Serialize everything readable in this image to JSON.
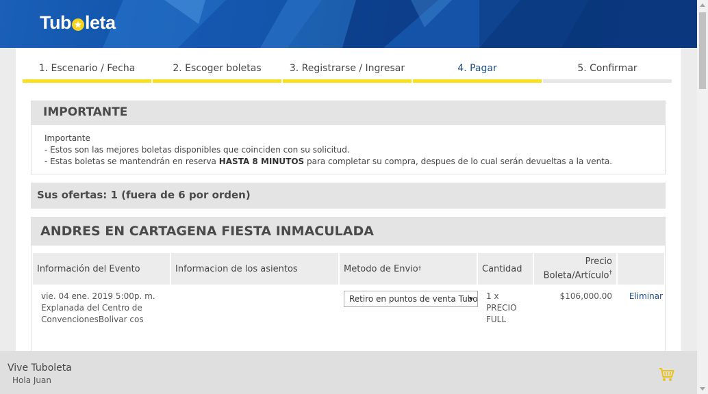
{
  "brand": {
    "logo_pre": "Tub",
    "logo_post": "leta",
    "accent_color": "#f7e11f",
    "header_color": "#0c4fa3"
  },
  "steps": [
    {
      "label": "1. Escenario / Fecha",
      "state": "done"
    },
    {
      "label": "2. Escoger boletas",
      "state": "done"
    },
    {
      "label": "3. Registrarse / Ingresar",
      "state": "done"
    },
    {
      "label": "4. Pagar",
      "state": "active"
    },
    {
      "label": "5. Confirmar",
      "state": "future"
    }
  ],
  "important": {
    "heading": "IMPORTANTE",
    "title": "Importante",
    "line1": "- Estos son las mejores boletas disponibles que coinciden con su solicitud.",
    "line2_pre": "- Estas boletas se mantendrán en reserva ",
    "line2_bold": "HASTA 8 MINUTOS",
    "line2_post": " para completar su compra, despues de lo cual serán devueltas a la venta."
  },
  "offers": {
    "text": "Sus ofertas: 1 (fuera de 6 por orden)"
  },
  "event": {
    "title": "ANDRES EN CARTAGENA FIESTA INMACULADA",
    "columns": {
      "event_info": "Información del Evento",
      "seat_info": "Informacion de los asientos",
      "delivery": "Metodo de Envio",
      "delivery_mark": "†",
      "quantity": "Cantidad",
      "price_line1": "Precio",
      "price_line2": "Boleta/Artículo",
      "price_mark": "†"
    },
    "row": {
      "date": "vie. 04 ene. 2019 5:00p. m.",
      "venue": "Explanada del Centro de ConvencionesBolivar cos",
      "seats": "",
      "delivery_selected": "Retiro en puntos de venta Tubo",
      "quantity": "1 x PRECIO FULL",
      "price": "$106,000.00",
      "remove": "Eliminar"
    }
  },
  "footer": {
    "title": "Vive Tuboleta",
    "greeting": "Hola Juan",
    "cart_icon": "cart-icon"
  }
}
